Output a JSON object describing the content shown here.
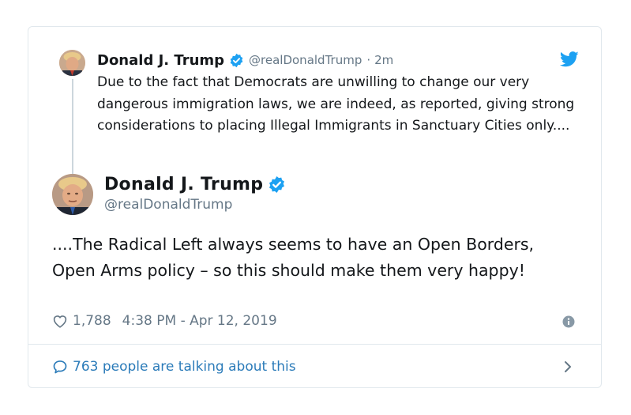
{
  "parent_tweet": {
    "name": "Donald J. Trump",
    "handle": "@realDonaldTrump",
    "separator": "·",
    "time_ago": "2m",
    "text": "Due to the fact that Democrats are unwilling to change our very dangerous immigration laws, we are indeed, as reported, giving strong considerations to placing Illegal Immigrants in Sanctuary Cities only...."
  },
  "main_tweet": {
    "name": "Donald J. Trump",
    "handle": "@realDonaldTrump",
    "text": "....The Radical Left always seems to have an Open Borders, Open Arms policy – so this should make them very happy!",
    "likes": "1,788",
    "timestamp": "4:38 PM - Apr 12, 2019"
  },
  "footer": {
    "talking_label": "763 people are talking about this"
  },
  "icons": {
    "verified": "verified-badge-icon",
    "twitter_logo": "twitter-bird-icon",
    "like": "heart-icon",
    "info": "info-icon",
    "reply": "speech-bubble-icon",
    "chevron": "chevron-right-icon"
  },
  "colors": {
    "brand_blue": "#1da1f2",
    "link_blue": "#2b7bb9",
    "secondary_text": "#657786",
    "primary_text": "#14171a",
    "border": "#e1e8ed"
  }
}
